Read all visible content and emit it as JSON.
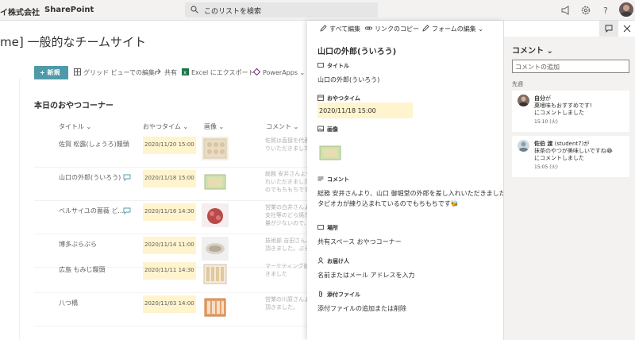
{
  "suite": {
    "org": "イ株式会社",
    "app": "SharePoint",
    "search_placeholder": "このリストを検索",
    "icons": [
      "megaphone-icon",
      "gear-icon",
      "help-icon",
      "avatar"
    ]
  },
  "site": {
    "title": "me] 一般的なチームサイト"
  },
  "command_bar": {
    "new": "新規",
    "grid": "グリッド ビューでの編集",
    "share": "共有",
    "excel": "Excel にエクスポート",
    "powerapps": "PowerApps"
  },
  "list": {
    "title": "本日のおやつコーナー",
    "columns": [
      "タイトル",
      "おやつタイム",
      "画像",
      "コメント"
    ],
    "rows": [
      {
        "title": "佐賀 松露(しょうろ)饅頭",
        "time": "2020/11/20 15:00",
        "comment_lines": [
          "佐賀は直接を代表",
          "りいただきました"
        ],
        "has_comment_icon": false
      },
      {
        "title": "山口の外郎(ういろう)",
        "time": "2020/11/18 15:00",
        "comment_lines": [
          "総務 安井さんより",
          "れいただきました",
          "のでもちもちです"
        ],
        "has_comment_icon": true
      },
      {
        "title": "ベルサイユの薔薇 ど...",
        "time": "2020/11/16 14:30",
        "comment_lines": [
          "営業の白井さんより",
          "支社等のどら焼き",
          "量が少ないので、早"
        ],
        "has_comment_icon": true
      },
      {
        "title": "博多ぶらぶら",
        "time": "2020/11/14 11:00",
        "comment_lines": [
          "技術部 吉田さんよ",
          "頂きました。ぶら"
        ],
        "has_comment_icon": false
      },
      {
        "title": "広島 もみじ饅頭",
        "time": "2020/11/11 14:30",
        "comment_lines": [
          "マーケティング部",
          "きました"
        ],
        "has_comment_icon": false
      },
      {
        "title": "八つ橋",
        "time": "2020/11/03 14:00",
        "comment_lines": [
          "営業の川原さんよ",
          "頂きました。"
        ],
        "has_comment_icon": false
      }
    ]
  },
  "form": {
    "toolbar": {
      "edit_all": "すべて編集",
      "copy_link": "リンクのコピー",
      "edit_form": "フォームの編集"
    },
    "title": "山口の外郎(ういろう)",
    "fields": {
      "title_label": "タイトル",
      "title_value": "山口の外郎(ういろう)",
      "time_label": "おやつタイム",
      "time_value": "2020/11/18 15:00",
      "image_label": "画像",
      "comment_label": "コメント",
      "comment_line1": "総務 安井さんより、山口 御堀堂の外郎を差し入れいただきました!",
      "comment_line2": "タピオカが練り込まれているのでもちもちです🐝",
      "place_label": "場所",
      "place_value": "共有スペース おやつコーナー",
      "deliver_label": "お届け人",
      "deliver_value": "名前またはメール アドレスを入力",
      "attach_label": "添付ファイル",
      "attach_value": "添付ファイルの追加または削除"
    }
  },
  "comments": {
    "title": "コメント",
    "input_placeholder": "コメントの追加",
    "section": "先週",
    "items": [
      {
        "name": "自分",
        "suffix": "が",
        "line1": "菓嗜味もおすすめです!",
        "line2": "にコメントしました",
        "time": "15:10 (火)"
      },
      {
        "name": "佐伯 渡",
        "suffix": " (student7)が",
        "line1": "抹茶のやつが美味しいですね😂",
        "line2": "にコメントしました",
        "time": "15:05 (火)"
      }
    ]
  },
  "colors": {
    "accent": "#4f9aa8",
    "highlight": "#fff4ce",
    "panel_bg": "#f3f2f1"
  }
}
